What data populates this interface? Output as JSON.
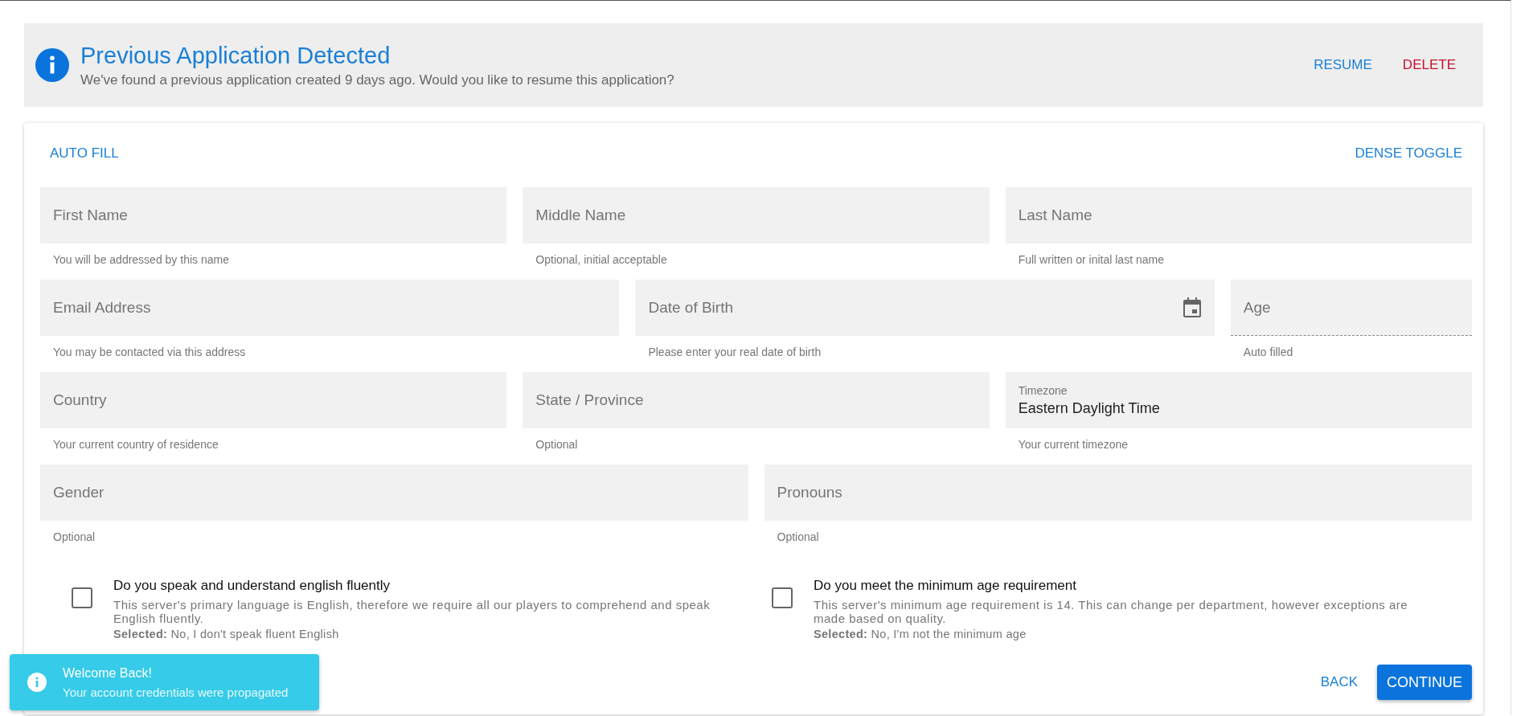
{
  "banner": {
    "title": "Previous Application Detected",
    "message": "We've found a previous application created 9 days ago. Would you like to resume this application?",
    "actions": [
      {
        "label": "RESUME",
        "kind": "primary"
      },
      {
        "label": "DELETE",
        "kind": "danger"
      }
    ]
  },
  "toolbar": {
    "left": "AUTO FILL",
    "right": "DENSE TOGGLE"
  },
  "field_rows": [
    {
      "fields": [
        {
          "kind": "text",
          "label": "First Name",
          "helper": "You will be addressed by this name"
        },
        {
          "kind": "text",
          "label": "Middle Name",
          "helper": "Optional, initial acceptable"
        },
        {
          "kind": "text",
          "label": "Last Name",
          "helper": "Full written or inital last name"
        }
      ]
    },
    {
      "fields": [
        {
          "kind": "text",
          "label": "Email Address",
          "helper": "You may be contacted via this address"
        },
        {
          "kind": "date",
          "label": "Date of Birth",
          "helper": "Please enter your real date of birth"
        },
        {
          "kind": "text",
          "label": "Age",
          "helper": "Auto filled",
          "disabled": true
        }
      ]
    },
    {
      "fields": [
        {
          "kind": "text",
          "label": "Country",
          "helper": "Your current country of residence"
        },
        {
          "kind": "text",
          "label": "State / Province",
          "helper": "Optional"
        },
        {
          "kind": "text",
          "label": "Timezone",
          "value": "Eastern Daylight Time",
          "helper": "Your current timezone"
        }
      ]
    },
    {
      "fields": [
        {
          "kind": "text",
          "label": "Gender",
          "helper": "Optional"
        },
        {
          "kind": "text",
          "label": "Pronouns",
          "helper": "Optional"
        }
      ]
    }
  ],
  "checkboxes": [
    {
      "question": "Do you speak and understand english fluently",
      "description": "This server's primary language is English, therefore we require all our players to comprehend and speak English fluently.",
      "selection": "**Selected:** No, I don't speak fluent English",
      "checked": false
    },
    {
      "question": "Do you meet the minimum age requirement",
      "description": "This server's minimum age requirement is 14. This can change per department, however exceptions are made based on quality.",
      "selection": "**Selected:** No, I'm not the minimum age",
      "checked": false
    }
  ],
  "actions": [
    {
      "label": "BACK",
      "kind": "text"
    },
    {
      "label": "CONTINUE",
      "kind": "contained"
    }
  ],
  "toast": {
    "title": "Welcome Back!",
    "message": "Your account credentials were propagated"
  }
}
